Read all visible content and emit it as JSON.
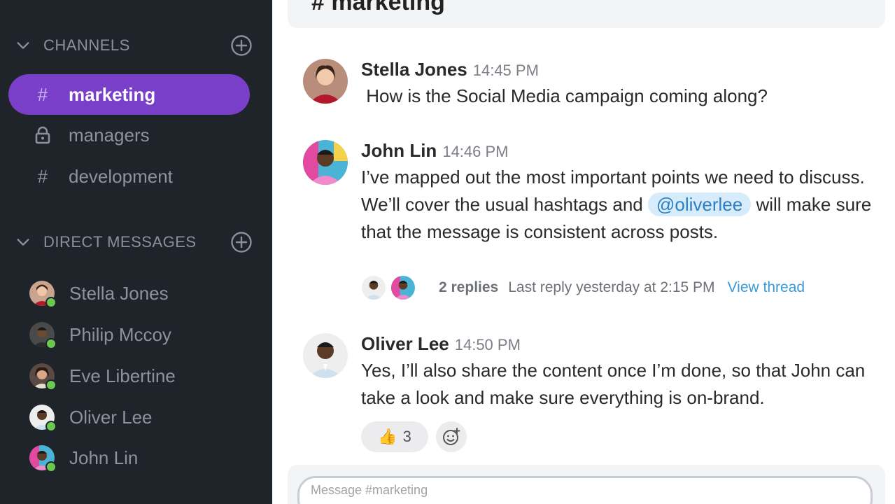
{
  "sidebar": {
    "channels_title": "CHANNELS",
    "dm_title": "DIRECT MESSAGES",
    "channels": [
      {
        "label": "marketing",
        "icon": "hash-icon",
        "active": true
      },
      {
        "label": "managers",
        "icon": "lock-icon",
        "active": false
      },
      {
        "label": "development",
        "icon": "hash-icon",
        "active": false
      }
    ],
    "direct_messages": [
      {
        "label": "Stella Jones",
        "status": "online"
      },
      {
        "label": "Philip Mccoy",
        "status": "online"
      },
      {
        "label": "Eve Libertine",
        "status": "online"
      },
      {
        "label": "Oliver Lee",
        "status": "online"
      },
      {
        "label": "John Lin",
        "status": "online"
      }
    ]
  },
  "channel": {
    "title": "# marketing"
  },
  "messages": [
    {
      "author": "Stella Jones",
      "time": "14:45 PM",
      "text": " How is the Social Media campaign coming along?"
    },
    {
      "author": "John Lin",
      "time": "14:46 PM",
      "text_before": "I’ve mapped out the most important points we need to discuss. We’ll cover the usual hashtags and ",
      "mention": "@oliverlee",
      "text_after": " will make sure that the message is consistent across posts."
    },
    {
      "author": "Oliver Lee",
      "time": "14:50 PM",
      "text": "Yes, I’ll also share the content once I’m done, so that John can take a look and make sure everything is on-brand."
    }
  ],
  "thread": {
    "replies": "2 replies",
    "last_reply": "Last reply yesterday at 2:15 PM",
    "view": "View thread"
  },
  "reaction": {
    "emoji": "👍",
    "count": "3"
  },
  "composer": {
    "placeholder": "Message #marketing"
  },
  "colors": {
    "sidebar_bg": "#1f242b",
    "active_channel": "#7a3fc8",
    "online": "#6bc950",
    "link": "#3a9ad9",
    "mention_bg": "#d6ecfb"
  }
}
